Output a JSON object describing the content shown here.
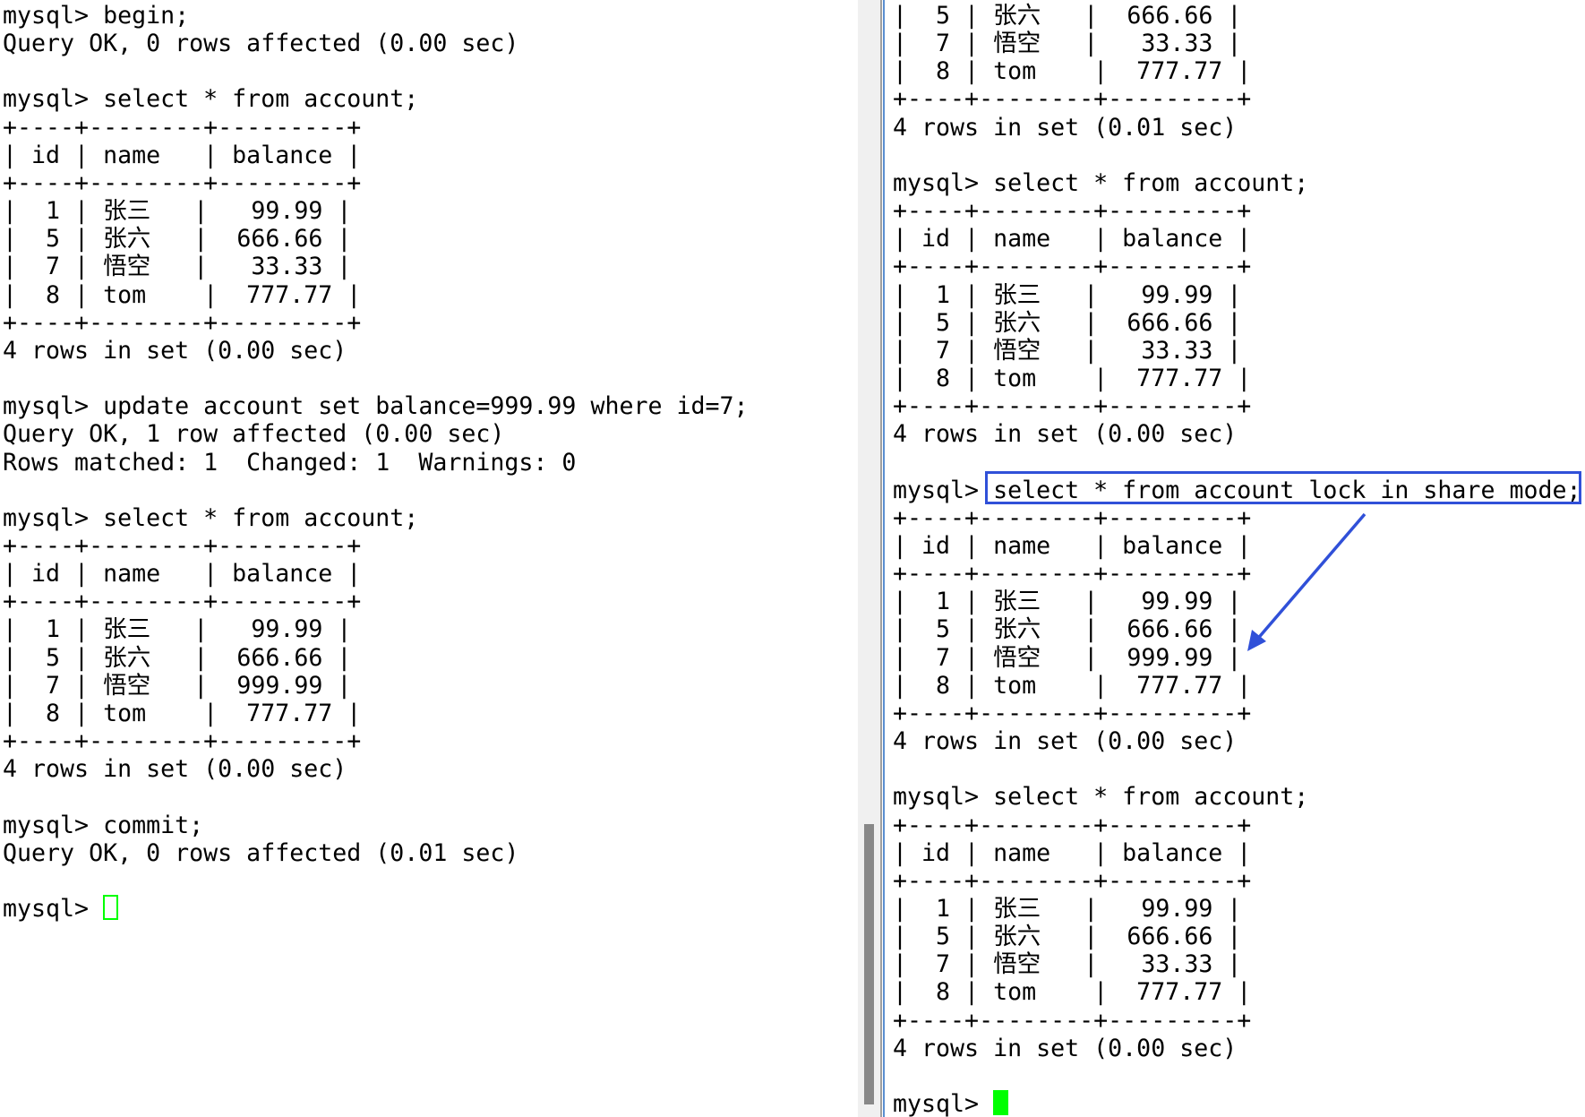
{
  "colors": {
    "cursor": "#00ff00",
    "highlight": "#3050d8",
    "text": "#000000"
  },
  "left": {
    "lines": [
      "mysql> begin;",
      "Query OK, 0 rows affected (0.00 sec)",
      "",
      "mysql> select * from account;",
      "+----+--------+---------+",
      "| id | name   | balance |",
      "+----+--------+---------+",
      "|  1 | 张三   |   99.99 |",
      "|  5 | 张六   |  666.66 |",
      "|  7 | 悟空   |   33.33 |",
      "|  8 | tom    |  777.77 |",
      "+----+--------+---------+",
      "4 rows in set (0.00 sec)",
      "",
      "mysql> update account set balance=999.99 where id=7;",
      "Query OK, 1 row affected (0.00 sec)",
      "Rows matched: 1  Changed: 1  Warnings: 0",
      "",
      "mysql> select * from account;",
      "+----+--------+---------+",
      "| id | name   | balance |",
      "+----+--------+---------+",
      "|  1 | 张三   |   99.99 |",
      "|  5 | 张六   |  666.66 |",
      "|  7 | 悟空   |  999.99 |",
      "|  8 | tom    |  777.77 |",
      "+----+--------+---------+",
      "4 rows in set (0.00 sec)",
      "",
      "mysql> commit;",
      "Query OK, 0 rows affected (0.01 sec)",
      "",
      "mysql> "
    ],
    "cursor_style": "hollow"
  },
  "right": {
    "lines": [
      "|  5 | 张六   |  666.66 |",
      "|  7 | 悟空   |   33.33 |",
      "|  8 | tom    |  777.77 |",
      "+----+--------+---------+",
      "4 rows in set (0.01 sec)",
      "",
      "mysql> select * from account;",
      "+----+--------+---------+",
      "| id | name   | balance |",
      "+----+--------+---------+",
      "|  1 | 张三   |   99.99 |",
      "|  5 | 张六   |  666.66 |",
      "|  7 | 悟空   |   33.33 |",
      "|  8 | tom    |  777.77 |",
      "+----+--------+---------+",
      "4 rows in set (0.00 sec)",
      "",
      "mysql> select * from account lock in share mode;",
      "+----+--------+---------+",
      "| id | name   | balance |",
      "+----+--------+---------+",
      "|  1 | 张三   |   99.99 |",
      "|  5 | 张六   |  666.66 |",
      "|  7 | 悟空   |  999.99 |",
      "|  8 | tom    |  777.77 |",
      "+----+--------+---------+",
      "4 rows in set (0.00 sec)",
      "",
      "mysql> select * from account;",
      "+----+--------+---------+",
      "| id | name   | balance |",
      "+----+--------+---------+",
      "|  1 | 张三   |   99.99 |",
      "|  5 | 张六   |  666.66 |",
      "|  7 | 悟空   |   33.33 |",
      "|  8 | tom    |  777.77 |",
      "+----+--------+---------+",
      "4 rows in set (0.00 sec)",
      "",
      "mysql> "
    ],
    "cursor_style": "solid"
  },
  "annotation": {
    "highlighted_command": "select * from account lock in share mode;",
    "arrow_icon": "arrow-down-left-icon"
  }
}
